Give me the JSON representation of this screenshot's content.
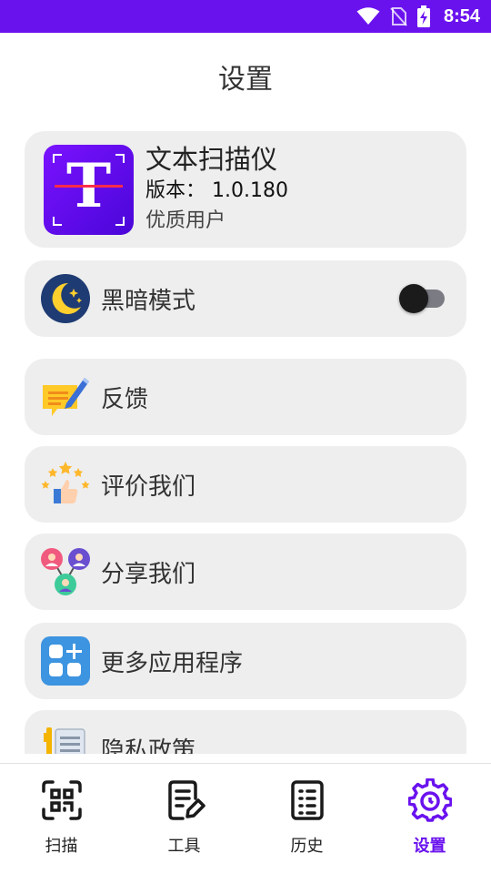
{
  "status_bar": {
    "time": "8:54"
  },
  "header": {
    "title": "设置"
  },
  "app_card": {
    "name": "文本扫描仪",
    "version": "版本： 1.0.180",
    "user_tier": "优质用户",
    "logo_letter": "T"
  },
  "settings": [
    {
      "label": "黑暗模式",
      "icon": "moon-icon",
      "toggle": false
    },
    {
      "label": "反馈",
      "icon": "feedback-icon"
    },
    {
      "label": "评价我们",
      "icon": "rate-icon"
    },
    {
      "label": "分享我们",
      "icon": "share-icon"
    },
    {
      "label": "更多应用程序",
      "icon": "more-apps-icon"
    },
    {
      "label": "隐私政策",
      "icon": "privacy-icon"
    }
  ],
  "bottom_nav": [
    {
      "label": "扫描",
      "icon": "qr-scan-icon"
    },
    {
      "label": "工具",
      "icon": "tools-icon"
    },
    {
      "label": "历史",
      "icon": "history-icon"
    },
    {
      "label": "设置",
      "icon": "gear-icon",
      "active": true
    }
  ],
  "colors": {
    "accent": "#6a12ee",
    "card_bg": "#eeeeee"
  }
}
